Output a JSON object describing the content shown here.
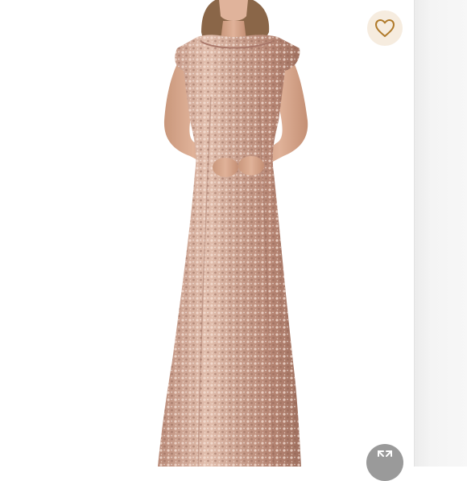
{
  "product": {
    "image_alt": "",
    "dress_color": "#c9a08f",
    "sequin_highlight": "#f3ddd0",
    "skin_color": "#d9a98f",
    "hair_color": "#8a6648"
  },
  "actions": {
    "like_icon": "heart-outline-icon",
    "like_color": "#b07a2a",
    "zoom_icon": "expand-icon"
  }
}
